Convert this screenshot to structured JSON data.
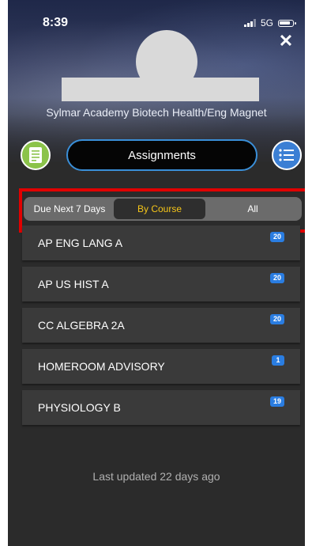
{
  "status_bar": {
    "time": "8:39",
    "network": "5G"
  },
  "header": {
    "school_name": "Sylmar Academy Biotech Health/Eng Magnet",
    "title": "Assignments"
  },
  "filter": {
    "options": [
      {
        "label": "Due Next 7 Days",
        "selected": false
      },
      {
        "label": "By Course",
        "selected": true
      },
      {
        "label": "All",
        "selected": false
      }
    ]
  },
  "courses": [
    {
      "name": "AP ENG LANG A",
      "count": "20"
    },
    {
      "name": "AP US HIST A",
      "count": "20"
    },
    {
      "name": "CC ALGEBRA 2A",
      "count": "20"
    },
    {
      "name": "HOMEROOM ADVISORY",
      "count": "1"
    },
    {
      "name": "PHYSIOLOGY B",
      "count": "19"
    }
  ],
  "footer": {
    "last_updated": "Last updated 22 days ago"
  },
  "colors": {
    "accent_blue": "#2a7de1",
    "selected_text": "#f5c518",
    "highlight_red": "#e10000",
    "green_icon": "#8bc34a"
  }
}
